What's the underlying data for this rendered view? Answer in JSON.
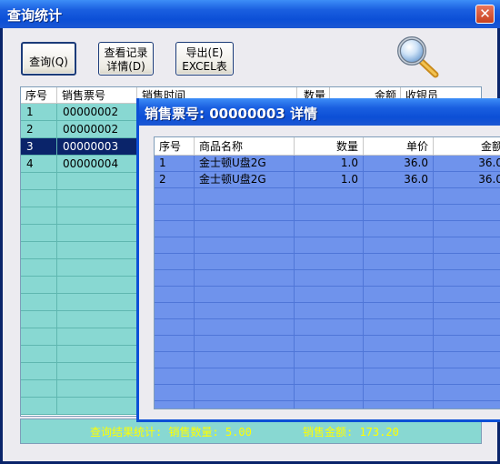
{
  "window": {
    "title": "查询统计",
    "close_glyph": "✕"
  },
  "toolbar": {
    "query_label": "查询(Q)",
    "view_label_line1": "查看记录",
    "view_label_line2": "详情(D)",
    "export_label_line1": "导出(E)",
    "export_label_line2": "EXCEL表",
    "search_icon": "magnifier-icon"
  },
  "list": {
    "columns": [
      "序号",
      "销售票号",
      "销售时间",
      "数量",
      "金额",
      "收银员"
    ],
    "rows": [
      {
        "no": "1",
        "ticket": "00000002"
      },
      {
        "no": "2",
        "ticket": "00000002"
      },
      {
        "no": "3",
        "ticket": "00000003"
      },
      {
        "no": "4",
        "ticket": "00000004"
      }
    ],
    "selected_index": 2
  },
  "footer": {
    "label": "查询结果统计: 销售数量: 5.00",
    "amount_label": "销售金额: 173.20"
  },
  "detail": {
    "title": "销售票号: 00000003 详情",
    "columns": [
      "序号",
      "商品名称",
      "数量",
      "单价",
      "金额"
    ],
    "rows": [
      {
        "no": "1",
        "name": "金士顿U盘2G",
        "qty": "1.0",
        "price": "36.0",
        "amount": "36.0"
      },
      {
        "no": "2",
        "name": "金士顿U盘2G",
        "qty": "1.0",
        "price": "36.0",
        "amount": "36.0"
      }
    ]
  },
  "colors": {
    "titlebar": "#0c4fd6",
    "list_row_bg": "#88d8d2",
    "detail_row_bg": "#6f93ec",
    "footer_text": "#ffff00"
  }
}
